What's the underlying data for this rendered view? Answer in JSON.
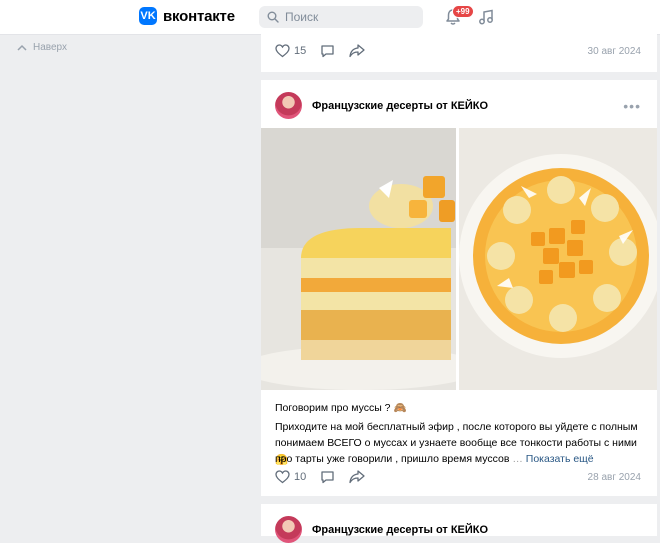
{
  "header": {
    "logo_text": "вконтакте",
    "search_placeholder": "Поиск",
    "notifications_badge": "+99"
  },
  "left_nav": {
    "up_label": "Наверх"
  },
  "previous_post": {
    "likes": "15",
    "date": "30 авг 2024"
  },
  "post": {
    "author": "Французские десерты от КЕЙКО",
    "title": "Поговорим про муссы ? 🙈",
    "line1": "Приходите на мой бесплатный эфир , после которого вы уйдете с полным",
    "line2": "понимаем ВСЕГО о муссах и узнаете вообще все тонкости работы с ними 🤗",
    "line3": "про тарты уже говорили , пришло время муссов",
    "show_more": "Показать ещё",
    "likes": "10",
    "date": "28 авг 2024"
  },
  "next_post": {
    "author": "Французские десерты от КЕЙКО"
  },
  "colors": {
    "accent": "#0077ff",
    "badge": "#e64646",
    "link": "#2a5885"
  }
}
